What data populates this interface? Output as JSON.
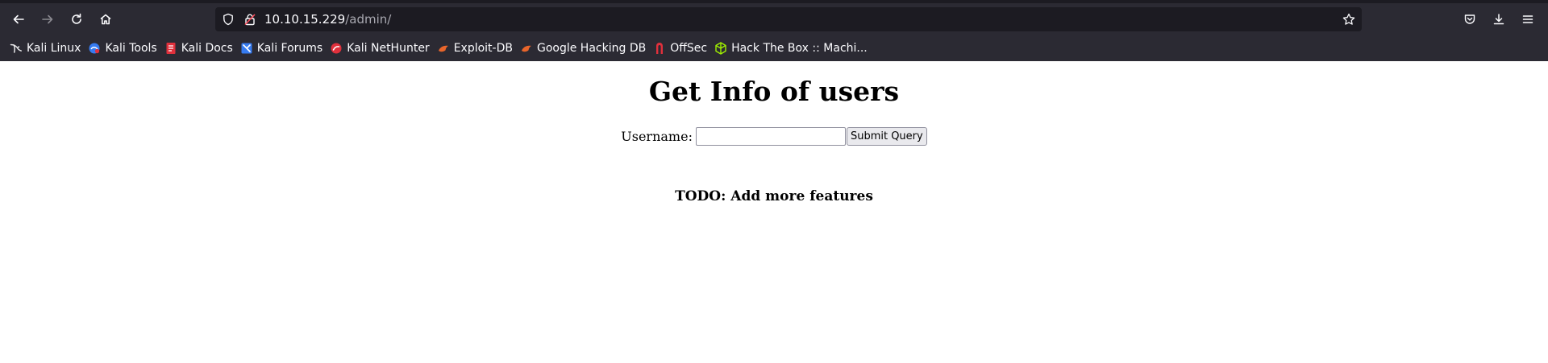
{
  "browser": {
    "url_host": "10.10.15.229",
    "url_path": "/admin/",
    "bookmarks": [
      {
        "label": "Kali Linux",
        "icon": "kali-dragon-icon"
      },
      {
        "label": "Kali Tools",
        "icon": "kali-tools-icon"
      },
      {
        "label": "Kali Docs",
        "icon": "kali-docs-icon"
      },
      {
        "label": "Kali Forums",
        "icon": "kali-forums-icon"
      },
      {
        "label": "Kali NetHunter",
        "icon": "kali-nethunter-icon"
      },
      {
        "label": "Exploit-DB",
        "icon": "exploit-db-icon"
      },
      {
        "label": "Google Hacking DB",
        "icon": "ghdb-icon"
      },
      {
        "label": "OffSec",
        "icon": "offsec-icon"
      },
      {
        "label": "Hack The Box :: Machi...",
        "icon": "hackthebox-icon"
      }
    ],
    "colors": {
      "chrome": "#2b2a33",
      "urlbar": "#1c1b22",
      "text": "#fbfbfe"
    }
  },
  "page": {
    "title": "Get Info of users",
    "username_label": "Username:",
    "username_value": "",
    "submit_label": "Submit Query",
    "todo": "TODO: Add more features"
  }
}
